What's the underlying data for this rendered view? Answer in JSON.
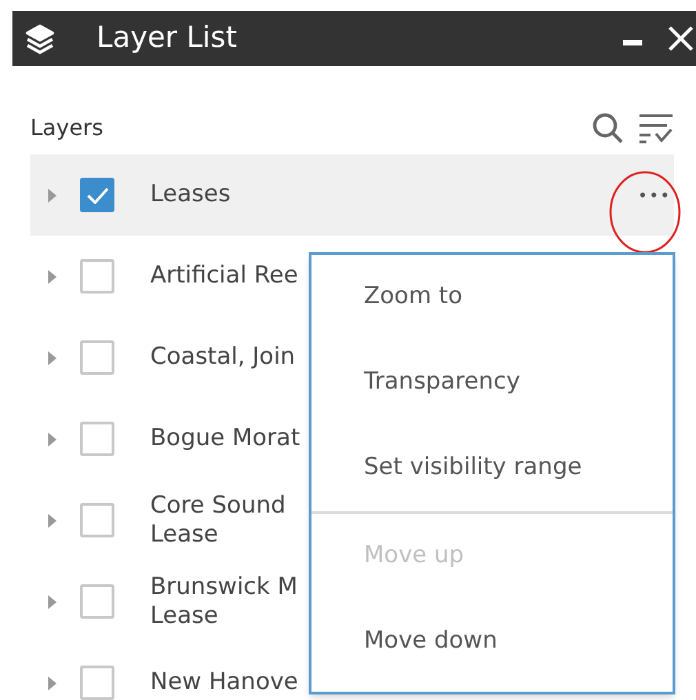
{
  "window": {
    "title": "Layer List"
  },
  "panel": {
    "heading": "Layers"
  },
  "layers": [
    {
      "lines": [
        "Leases"
      ],
      "checked": true,
      "highlighted": true,
      "more": "•••"
    },
    {
      "lines": [
        "Artificial Ree"
      ],
      "checked": false,
      "highlighted": false
    },
    {
      "lines": [
        "Coastal, Join"
      ],
      "checked": false,
      "highlighted": false
    },
    {
      "lines": [
        "Bogue Morat"
      ],
      "checked": false,
      "highlighted": false
    },
    {
      "lines": [
        "Core Sound",
        "Lease"
      ],
      "checked": false,
      "highlighted": false
    },
    {
      "lines": [
        "Brunswick M",
        "Lease"
      ],
      "checked": false,
      "highlighted": false
    },
    {
      "lines": [
        "New Hanove"
      ],
      "checked": false,
      "highlighted": false
    }
  ],
  "menu": {
    "items": [
      {
        "label": "Zoom to",
        "disabled": false
      },
      {
        "label": "Transparency",
        "disabled": false
      },
      {
        "label": "Set visibility range",
        "disabled": false
      },
      {
        "kind": "divider"
      },
      {
        "label": "Move up",
        "disabled": true
      },
      {
        "label": "Move down",
        "disabled": false
      }
    ]
  }
}
